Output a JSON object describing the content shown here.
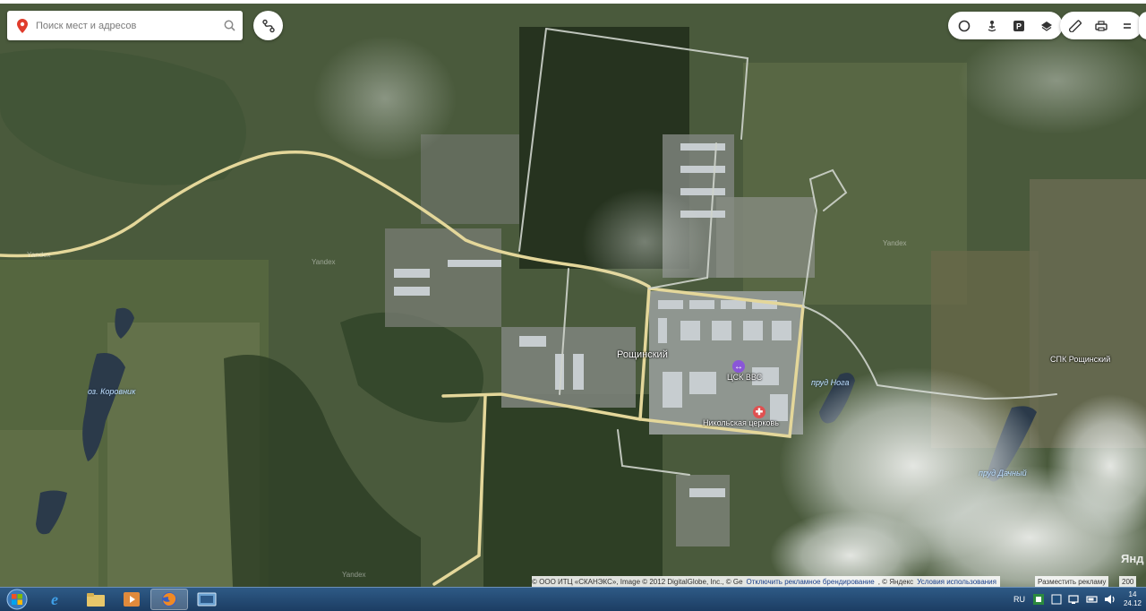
{
  "search": {
    "placeholder": "Поиск мест и адресов"
  },
  "controls": {
    "top_right_group_1": [
      "traffic-icon",
      "panorama-icon",
      "parking-icon",
      "layers-icon"
    ],
    "top_right_group_2": [
      "ruler-icon",
      "print-icon",
      "menu-icon"
    ]
  },
  "map": {
    "settlement": "Рощинский",
    "labels": {
      "lake_korovnik": "оз. Коровник",
      "pond_noga": "пруд Нога",
      "pond_dachny": "пруд Дачный",
      "spk": "СПК Рощинский",
      "cskvvs": "ЦСК ВВС",
      "church": "Никольская церковь",
      "watermark": "Yandex"
    },
    "colors": {
      "road": "#e4d79a",
      "water": "#2b3a4a",
      "forest": "#2f4226",
      "field": "#5a6b45"
    }
  },
  "attribution": {
    "text": "© ООО ИТЦ «СКАНЭКС», Image © 2012 DigitalGlobe, Inc., © Ge",
    "disable_ads": "Отключить рекламное брендирование",
    "yandex": ", © Яндекс",
    "terms": "Условия использования",
    "advertise": "Разместить рекламу",
    "scale": "200",
    "logo": "Янд"
  },
  "taskbar": {
    "apps": [
      "windows-start",
      "internet-explorer",
      "file-explorer",
      "media-player",
      "firefox",
      "screenshot-app"
    ],
    "language": "RU",
    "time": "14",
    "date": "24.12"
  }
}
